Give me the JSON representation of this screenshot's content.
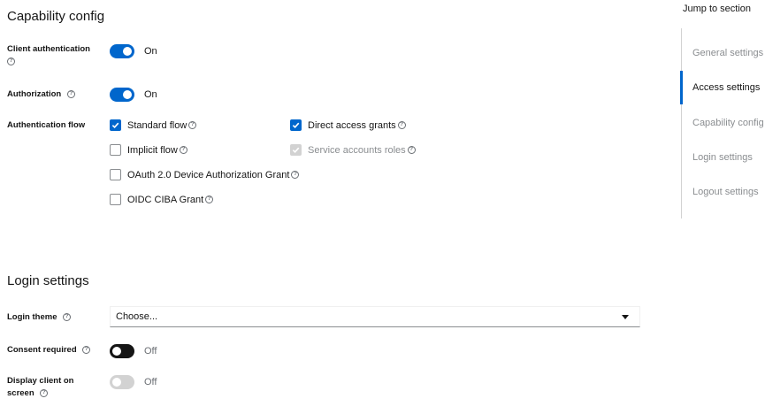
{
  "capability": {
    "title": "Capability config",
    "client_auth": {
      "label": "Client authentication",
      "state": "On",
      "help": "?"
    },
    "authorization": {
      "label": "Authorization",
      "state": "On",
      "help": "?"
    },
    "auth_flow": {
      "label": "Authentication flow",
      "options": [
        {
          "label": "Standard flow",
          "checked": true,
          "disabled": false
        },
        {
          "label": "Direct access grants",
          "checked": true,
          "disabled": false
        },
        {
          "label": "Implicit flow",
          "checked": false,
          "disabled": false
        },
        {
          "label": "Service accounts roles",
          "checked": true,
          "disabled": true
        },
        {
          "label": "OAuth 2.0 Device Authorization Grant",
          "checked": false,
          "disabled": false
        },
        {
          "label": "OIDC CIBA Grant",
          "checked": false,
          "disabled": false
        }
      ]
    }
  },
  "login": {
    "title": "Login settings",
    "theme": {
      "label": "Login theme",
      "value": "Choose..."
    },
    "consent": {
      "label": "Consent required",
      "state": "Off"
    },
    "display_client": {
      "label": "Display client on screen",
      "state": "Off"
    }
  },
  "jump": {
    "title": "Jump to section",
    "items": [
      {
        "label": "General settings",
        "active": false
      },
      {
        "label": "Access settings",
        "active": true
      },
      {
        "label": "Capability config",
        "active": false
      },
      {
        "label": "Login settings",
        "active": false
      },
      {
        "label": "Logout settings",
        "active": false
      }
    ]
  },
  "colors": {
    "accent": "#0066cc",
    "text": "#151515",
    "muted": "#6a6e73",
    "disabled": "#d2d2d2"
  }
}
